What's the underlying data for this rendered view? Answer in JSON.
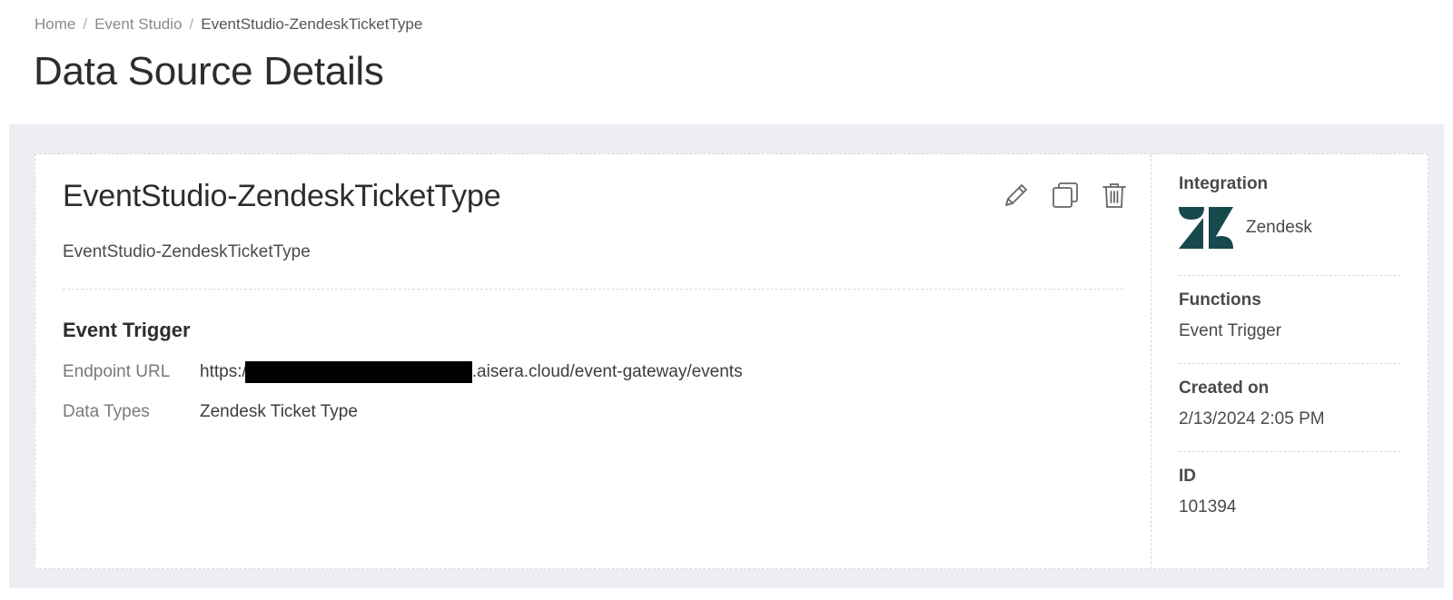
{
  "breadcrumb": {
    "items": [
      "Home",
      "Event Studio",
      "EventStudio-ZendeskTicketType"
    ],
    "separator": "/"
  },
  "page_title": "Data Source Details",
  "source": {
    "name": "EventStudio-ZendeskTicketType",
    "description": "EventStudio-ZendeskTicketType",
    "actions": {
      "edit_icon": "pencil-icon",
      "copy_icon": "copy-icon",
      "delete_icon": "trash-icon"
    }
  },
  "trigger": {
    "section_title": "Event Trigger",
    "endpoint_label": "Endpoint URL",
    "endpoint_prefix": "https:/",
    "endpoint_suffix": ".aisera.cloud/event-gateway/events",
    "data_types_label": "Data Types",
    "data_types_value": "Zendesk Ticket Type"
  },
  "sidebar": {
    "integration_label": "Integration",
    "integration_name": "Zendesk",
    "integration_icon": "zendesk-logo-icon",
    "functions_label": "Functions",
    "functions_value": "Event Trigger",
    "created_label": "Created on",
    "created_value": "2/13/2024 2:05 PM",
    "id_label": "ID",
    "id_value": "101394"
  },
  "colors": {
    "panel_bg": "#edeef3",
    "zendesk_brand": "#17494d",
    "icon_gray": "#666666"
  }
}
